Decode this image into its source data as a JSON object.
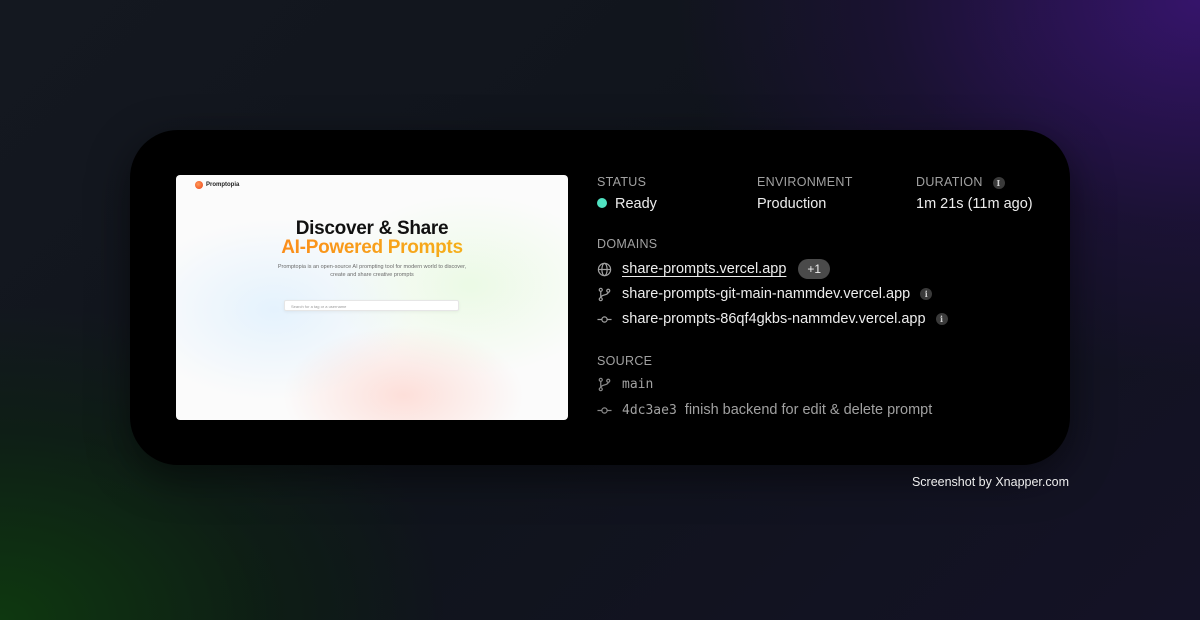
{
  "preview": {
    "brand": "Promptopia",
    "title_line1": "Discover & Share",
    "title_line2": "AI-Powered Prompts",
    "description": "Promptopia is an open-source AI prompting tool for modern world to discover, create and share creative prompts",
    "search_placeholder": "Search for a tag or a username"
  },
  "status": {
    "label": "STATUS",
    "value": "Ready",
    "color": "#50e3c2"
  },
  "environment": {
    "label": "ENVIRONMENT",
    "value": "Production"
  },
  "duration": {
    "label": "DURATION",
    "value": "1m 21s (11m ago)",
    "info": "i"
  },
  "domains": {
    "label": "DOMAINS",
    "items": [
      {
        "text": "share-prompts.vercel.app",
        "badge": "+1",
        "icon": "globe-icon"
      },
      {
        "text": "share-prompts-git-main-nammdev.vercel.app",
        "info": "i",
        "icon": "branch-icon"
      },
      {
        "text": "share-prompts-86qf4gkbs-nammdev.vercel.app",
        "info": "i",
        "icon": "commit-icon"
      }
    ]
  },
  "source": {
    "label": "SOURCE",
    "branch": "main",
    "commit_hash": "4dc3ae3",
    "commit_message": "finish backend for edit & delete prompt"
  },
  "footer": "Screenshot by Xnapper.com"
}
